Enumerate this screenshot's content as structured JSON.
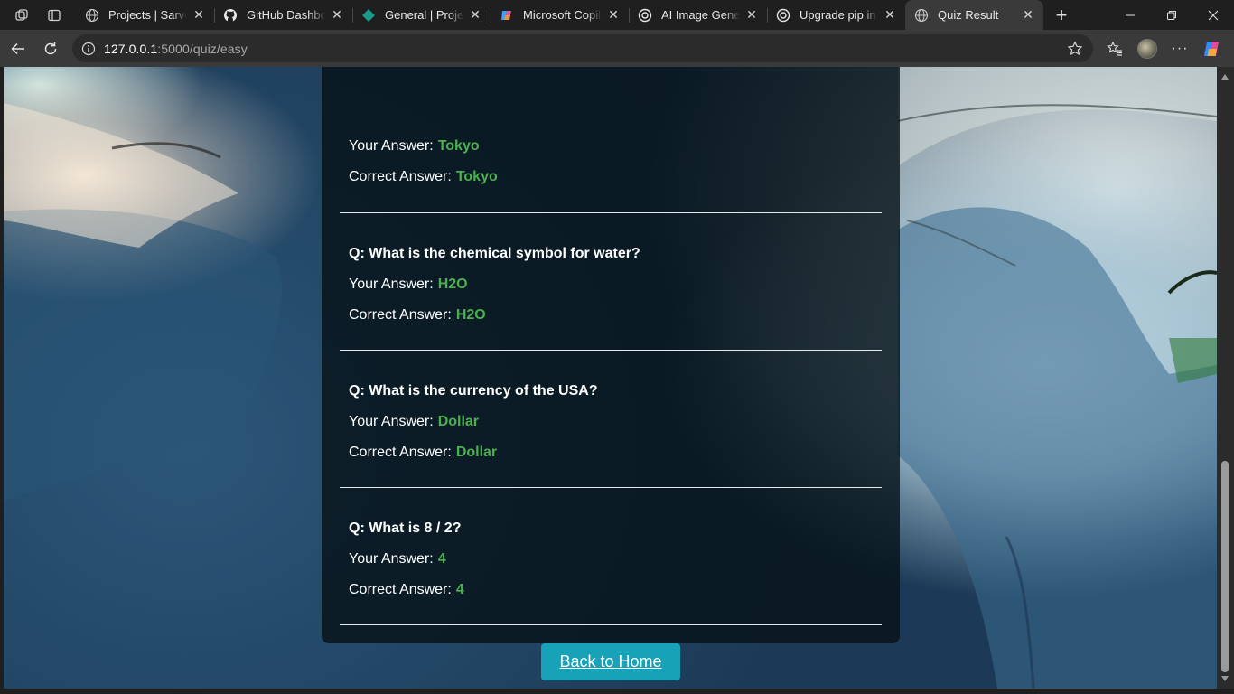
{
  "browser": {
    "tabs": [
      {
        "title": "Projects | Sarvoth",
        "icon": "globe-icon",
        "active": false
      },
      {
        "title": "GitHub Dashboard",
        "icon": "github-icon",
        "active": false
      },
      {
        "title": "General | Project",
        "icon": "diamond-icon",
        "active": false
      },
      {
        "title": "Microsoft Copilot",
        "icon": "copilot-icon",
        "active": false
      },
      {
        "title": "AI Image Generat",
        "icon": "openai-icon",
        "active": false
      },
      {
        "title": "Upgrade pip in C",
        "icon": "openai-icon",
        "active": false
      },
      {
        "title": "Quiz Result",
        "icon": "globe-icon",
        "active": true
      }
    ],
    "address": {
      "host": "127.0.0.1",
      "path": ":5000/quiz/easy"
    }
  },
  "quiz": {
    "your_answer_label": "Your Answer:",
    "correct_answer_label": "Correct Answer:",
    "partial": {
      "your_answer": "Tokyo",
      "correct_answer": "Tokyo"
    },
    "items": [
      {
        "question": "Q: What is the chemical symbol for water?",
        "your_answer": "H2O",
        "correct_answer": "H2O"
      },
      {
        "question": "Q: What is the currency of the USA?",
        "your_answer": "Dollar",
        "correct_answer": "Dollar"
      },
      {
        "question": "Q: What is 8 / 2?",
        "your_answer": "4",
        "correct_answer": "4"
      }
    ],
    "back_button": "Back to Home"
  },
  "colors": {
    "correct": "#4caf50",
    "button": "#17a2b8",
    "card": "#06121B"
  }
}
